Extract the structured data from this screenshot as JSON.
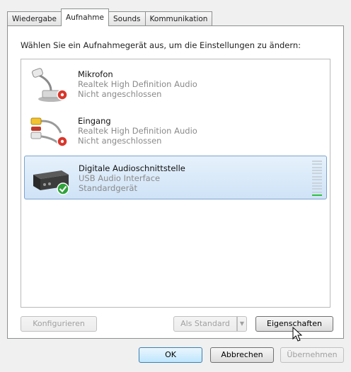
{
  "tabs": [
    {
      "label": "Wiedergabe",
      "active": false
    },
    {
      "label": "Aufnahme",
      "active": true
    },
    {
      "label": "Sounds",
      "active": false
    },
    {
      "label": "Kommunikation",
      "active": false
    }
  ],
  "instruction": "Wählen Sie ein Aufnahmegerät aus, um die Einstellungen zu ändern:",
  "devices": [
    {
      "name": "Mikrofon",
      "driver": "Realtek High Definition Audio",
      "status": "Nicht angeschlossen",
      "icon": "microphone-icon",
      "badge": "disconnected-badge",
      "selected": false
    },
    {
      "name": "Eingang",
      "driver": "Realtek High Definition Audio",
      "status": "Nicht angeschlossen",
      "icon": "audio-cable-icon",
      "badge": "disconnected-badge",
      "selected": false
    },
    {
      "name": "Digitale Audioschnittstelle",
      "driver": "USB Audio Interface",
      "status": "Standardgerät",
      "icon": "audio-interface-icon",
      "badge": "default-check-badge",
      "selected": true,
      "level": 0.1
    }
  ],
  "buttons": {
    "configure": "Konfigurieren",
    "set_default": "Als Standard",
    "properties": "Eigenschaften",
    "ok": "OK",
    "cancel": "Abbrechen",
    "apply": "Übernehmen"
  },
  "colors": {
    "selection_border": "#7da2ce",
    "badge_red": "#d9362b",
    "badge_green": "#2ea33a",
    "meter_green": "#2ec13c"
  }
}
